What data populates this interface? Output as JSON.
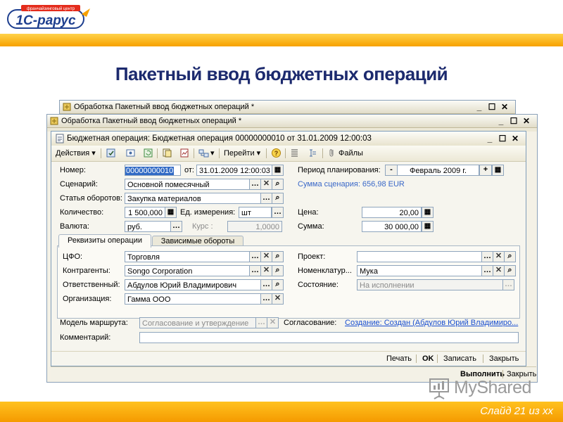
{
  "slide": {
    "title": "Пакетный ввод бюджетных операций",
    "counter": "Слайд 21 из хх",
    "logo_text": "1С-рарус",
    "logo_subtext": "франчайзинговый центр",
    "watermark": "MyShared"
  },
  "background_windows": {
    "window1_title": "Обработка  Пакетный ввод бюджетных операций *",
    "window2_title": "Обработка  Пакетный ввод бюджетных операций *",
    "controls": [
      "_",
      "☐",
      "✕"
    ]
  },
  "form": {
    "title": "Бюджетная операция: Бюджетная операция 00000000010 от 31.01.2009 12:00:03",
    "toolbar": {
      "actions": "Действия",
      "goto": "Перейти",
      "files": "Файлы"
    },
    "fields": {
      "number_label": "Номер:",
      "number_value": "00000000010",
      "date_label": "от:",
      "date_value": "31.01.2009 12:00:03",
      "period_label": "Период планирования:",
      "period_minus": "-",
      "period_value": "Февраль 2009 г.",
      "period_plus": "+",
      "scenario_label": "Сценарий:",
      "scenario_value": "Основной помесячный",
      "scenario_sum": "Сумма сценария: 656,98 EUR",
      "article_label": "Статья оборотов:",
      "article_value": "Закупка материалов",
      "qty_label": "Количество:",
      "qty_value": "1 500,000",
      "unit_label": "Ед. измерения:",
      "unit_value": "шт",
      "price_label": "Цена:",
      "price_value": "20,00",
      "currency_label": "Валюта:",
      "currency_value": "руб.",
      "rate_label": "Курс :",
      "rate_value": "1,0000",
      "sum_label": "Сумма:",
      "sum_value": "30 000,00"
    },
    "tabs": [
      "Реквизиты операции",
      "Зависимые обороты"
    ],
    "tab_fields": {
      "cfo_label": "ЦФО:",
      "cfo_value": "Торговля",
      "project_label": "Проект:",
      "project_value": "",
      "contractors_label": "Контрагенты:",
      "contractors_value": "Songo Corporation",
      "nomenclature_label": "Номенклатур...",
      "nomenclature_value": "Мука",
      "responsible_label": "Ответственный:",
      "responsible_value": "Абдулов Юрий Владимирович",
      "state_label": "Состояние:",
      "state_value": "На исполнении",
      "org_label": "Организация:",
      "org_value": "Гамма ООО"
    },
    "route": {
      "model_label": "Модель маршрута:",
      "model_value": "Согласование и утверждение",
      "approval_label": "Согласование:",
      "approval_link": "Создание: Создан (Абдулов Юрий Владимиро..."
    },
    "comment_label": "Комментарий:",
    "comment_value": "",
    "buttons": {
      "print": "Печать",
      "ok": "OK",
      "save": "Записать",
      "close": "Закрыть"
    }
  },
  "outer_footer": {
    "execute": "Выполнить",
    "close": "Закрыть"
  }
}
